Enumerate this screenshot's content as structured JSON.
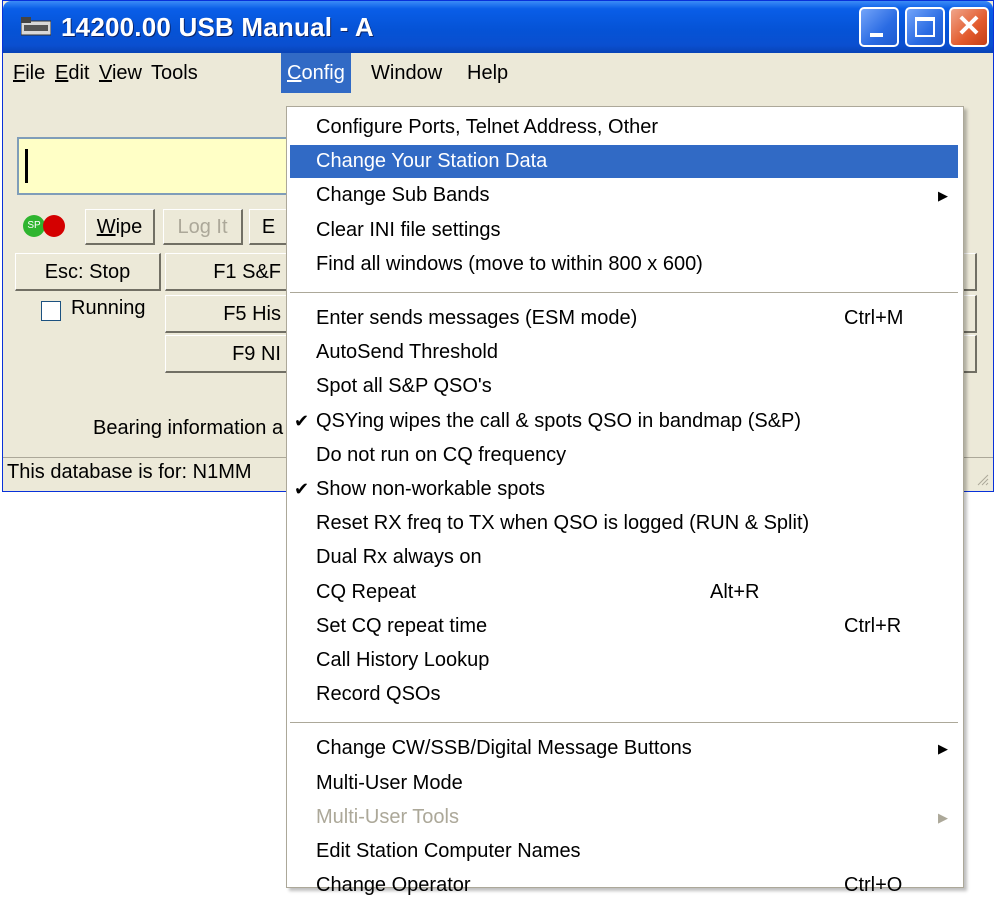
{
  "window": {
    "title": "14200.00 USB Manual - A",
    "controls": {
      "close_glyph": "✕"
    }
  },
  "menubar": {
    "items": [
      {
        "label": "File"
      },
      {
        "label": "Edit"
      },
      {
        "label": "View"
      },
      {
        "label": "Tools"
      },
      {
        "label": "Config"
      },
      {
        "label": "Window"
      },
      {
        "label": "Help"
      }
    ]
  },
  "entry": {
    "value": ""
  },
  "indicators": {
    "sp_label": "SP"
  },
  "buttons": {
    "wipe": "Wipe",
    "log_it": "Log It",
    "e_partial": "E",
    "esc_stop": "Esc: Stop",
    "f1": "F1 S&F",
    "f5": "F5 His",
    "f9": "F9 NI"
  },
  "running": {
    "label": "Running",
    "checked": false
  },
  "bearing_text": "Bearing information a",
  "status_text": "This database is for: N1MM",
  "config_menu": {
    "items": [
      {
        "label": "Configure Ports, Telnet Address, Other"
      },
      {
        "label": "Change Your Station Data",
        "highlighted": true
      },
      {
        "label": "Change Sub Bands",
        "submenu": true
      },
      {
        "label": "Clear INI file settings"
      },
      {
        "label": "Find all windows (move to within 800 x 600)"
      },
      {
        "separator": true
      },
      {
        "label": "Enter sends messages (ESM mode)",
        "shortcut": "Ctrl+M"
      },
      {
        "label": "AutoSend Threshold"
      },
      {
        "label": "Spot all S&P QSO's"
      },
      {
        "label": "QSYing wipes the call & spots QSO in bandmap (S&P)",
        "checked": true
      },
      {
        "label": "Do not run on CQ frequency"
      },
      {
        "label": "Show non-workable spots",
        "checked": true
      },
      {
        "label": "Reset RX freq to TX when QSO is logged (RUN & Split)"
      },
      {
        "label": "Dual Rx always on"
      },
      {
        "label": "CQ Repeat",
        "shortcut": "Alt+R",
        "shortcut_mid": true
      },
      {
        "label": "Set CQ repeat time",
        "shortcut": "Ctrl+R"
      },
      {
        "label": "Call History Lookup"
      },
      {
        "label": "Record QSOs"
      },
      {
        "separator": true
      },
      {
        "label": "Change CW/SSB/Digital Message Buttons",
        "submenu": true
      },
      {
        "label": "Multi-User Mode"
      },
      {
        "label": "Multi-User Tools",
        "disabled": true,
        "submenu": true
      },
      {
        "label": "Edit Station Computer Names"
      },
      {
        "label": "Change Operator",
        "shortcut": "Ctrl+O"
      }
    ]
  },
  "colors": {
    "titlebar": "#0553d6",
    "highlight": "#316ac5",
    "entry_bg": "#ffffc6",
    "face": "#ece9d8"
  }
}
